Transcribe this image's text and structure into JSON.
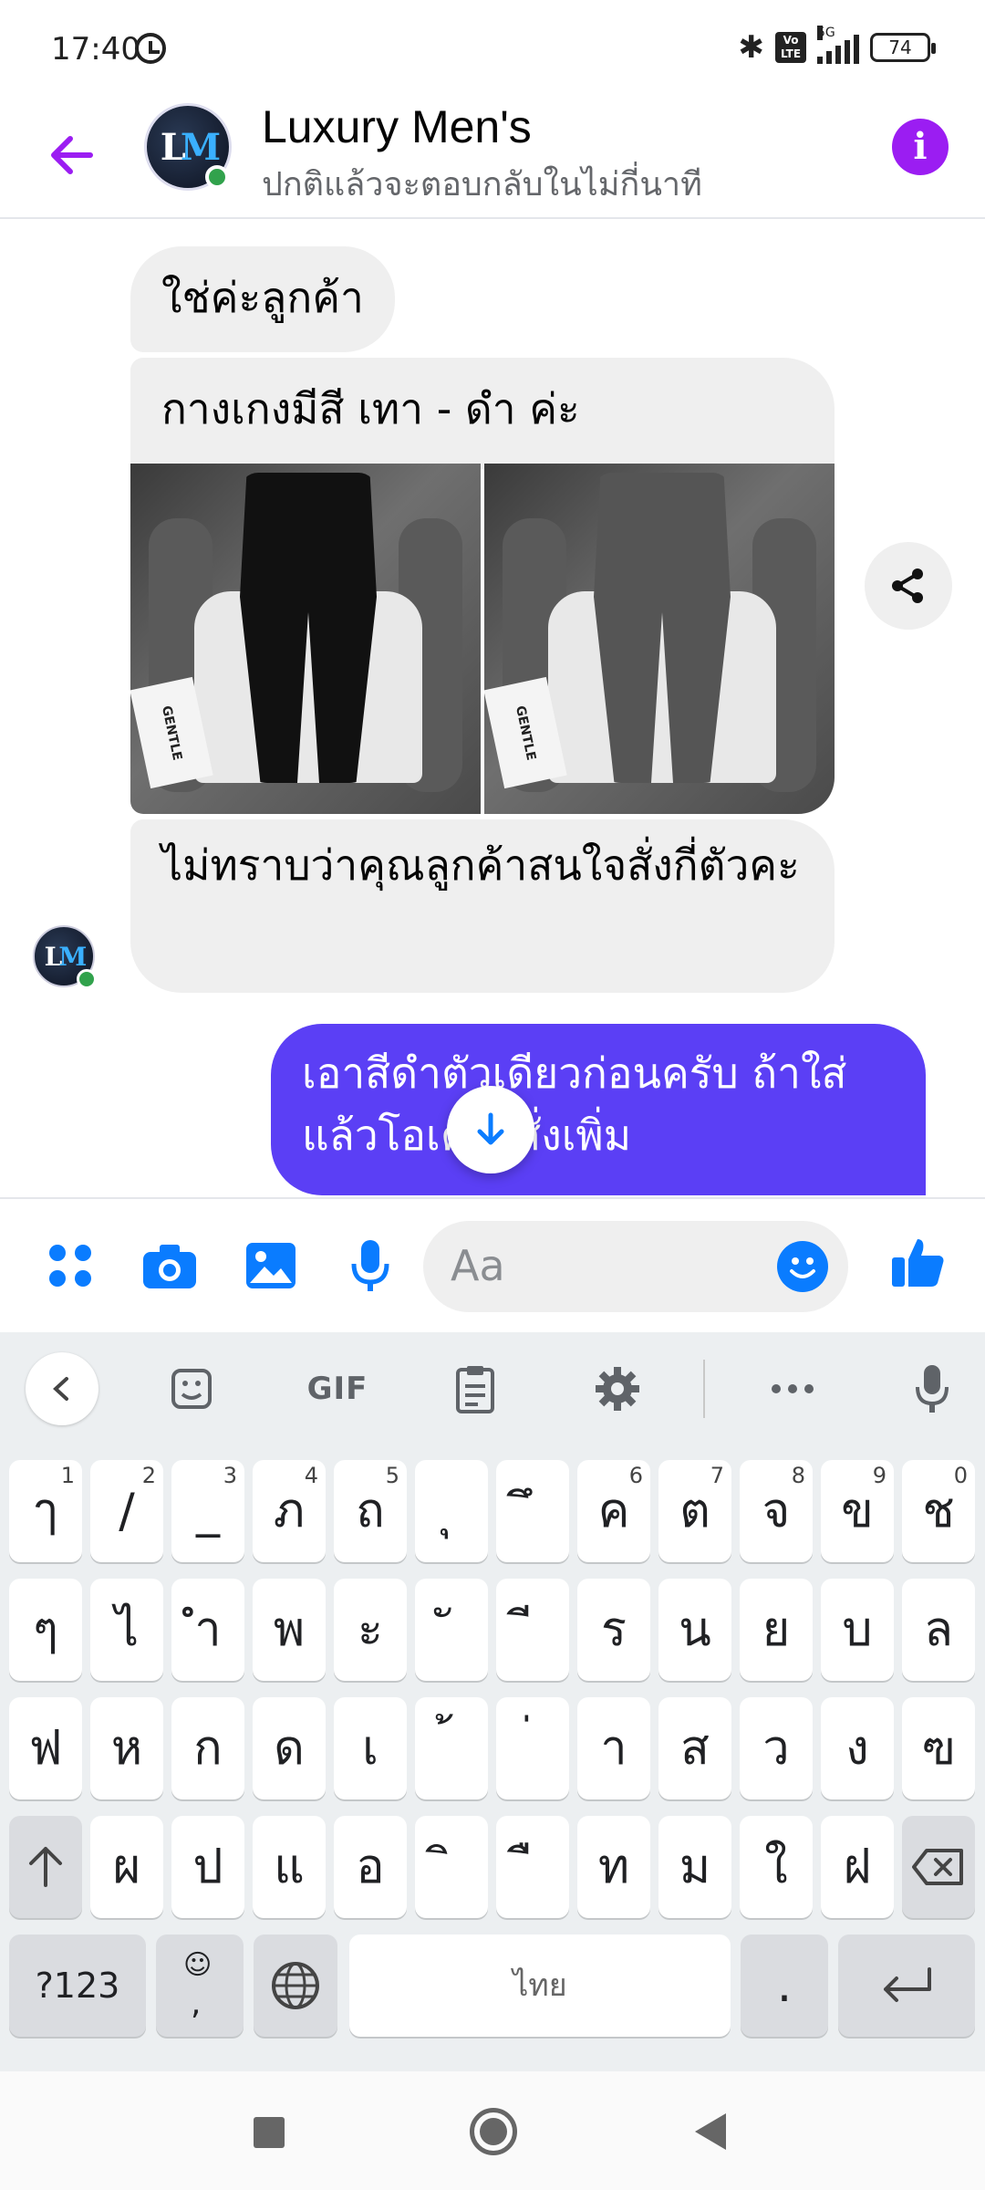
{
  "status_bar": {
    "time": "17:40",
    "network": "5G",
    "volte": "Vo LTE",
    "battery": "74"
  },
  "header": {
    "contact_name": "Luxury Men's",
    "status_text": "ปกติแล้วจะตอบกลับในไม่กี่นาที",
    "avatar_initials": "LM",
    "avatar_brand": "LUXURY MEN'S"
  },
  "messages": [
    {
      "from": "contact",
      "text": "ใช่ค่ะลูกค้า"
    },
    {
      "from": "contact",
      "text": "กางเกงมีสี เทา - ดำ ค่ะ"
    },
    {
      "from": "contact",
      "type": "photos",
      "photo_labels": [
        "GENTLE",
        "GENTLE"
      ]
    },
    {
      "from": "contact",
      "text": "ไม่ทราบว่าคุณลูกค้าสนใจสั่งกี่ตัวคะ"
    },
    {
      "from": "me",
      "text": "เอาสีดำตัวเดียวก่อนครับ ถ้าใส่แล้วโอเคจะสั่งเพิ่ม"
    }
  ],
  "composer": {
    "placeholder": "Aa",
    "icons": [
      "apps-icon",
      "camera-icon",
      "gallery-icon",
      "microphone-icon",
      "emoji-icon",
      "thumbs-up-icon"
    ]
  },
  "keyboard": {
    "toolbar": [
      "back-chevron-icon",
      "sticker-icon",
      "GIF",
      "clipboard-icon",
      "gear-icon",
      "more-icon",
      "microphone-icon"
    ],
    "row1": [
      [
        "ๅ",
        "1"
      ],
      [
        "/",
        "2"
      ],
      [
        "_",
        "3"
      ],
      [
        "ภ",
        "4"
      ],
      [
        "ถ",
        "5"
      ],
      [
        "ุ",
        ""
      ],
      [
        "ึ",
        ""
      ],
      [
        "ค",
        "6"
      ],
      [
        "ต",
        "7"
      ],
      [
        "จ",
        "8"
      ],
      [
        "ข",
        "9"
      ],
      [
        "ช",
        "0"
      ]
    ],
    "row2": [
      "ๆ",
      "ไ",
      "ำ",
      "พ",
      "ะ",
      "ั",
      "ี",
      "ร",
      "น",
      "ย",
      "บ",
      "ล"
    ],
    "row3": [
      "ฟ",
      "ห",
      "ก",
      "ด",
      "เ",
      "้",
      "่",
      "า",
      "ส",
      "ว",
      "ง",
      "ฃ"
    ],
    "row4": [
      "ผ",
      "ป",
      "แ",
      "อ",
      "ิ",
      "ื",
      "ท",
      "ม",
      "ใ",
      "ฝ"
    ],
    "symbols_key": "?123",
    "emoji_comma_key": ",",
    "space_label": "ไทย",
    "period_key": "."
  },
  "colors": {
    "accent": "#9b1df2",
    "my_bubble": "#5b3ff5",
    "contact_bubble": "#efefef",
    "messenger_blue": "#0a7cff",
    "online": "#31a24c"
  }
}
